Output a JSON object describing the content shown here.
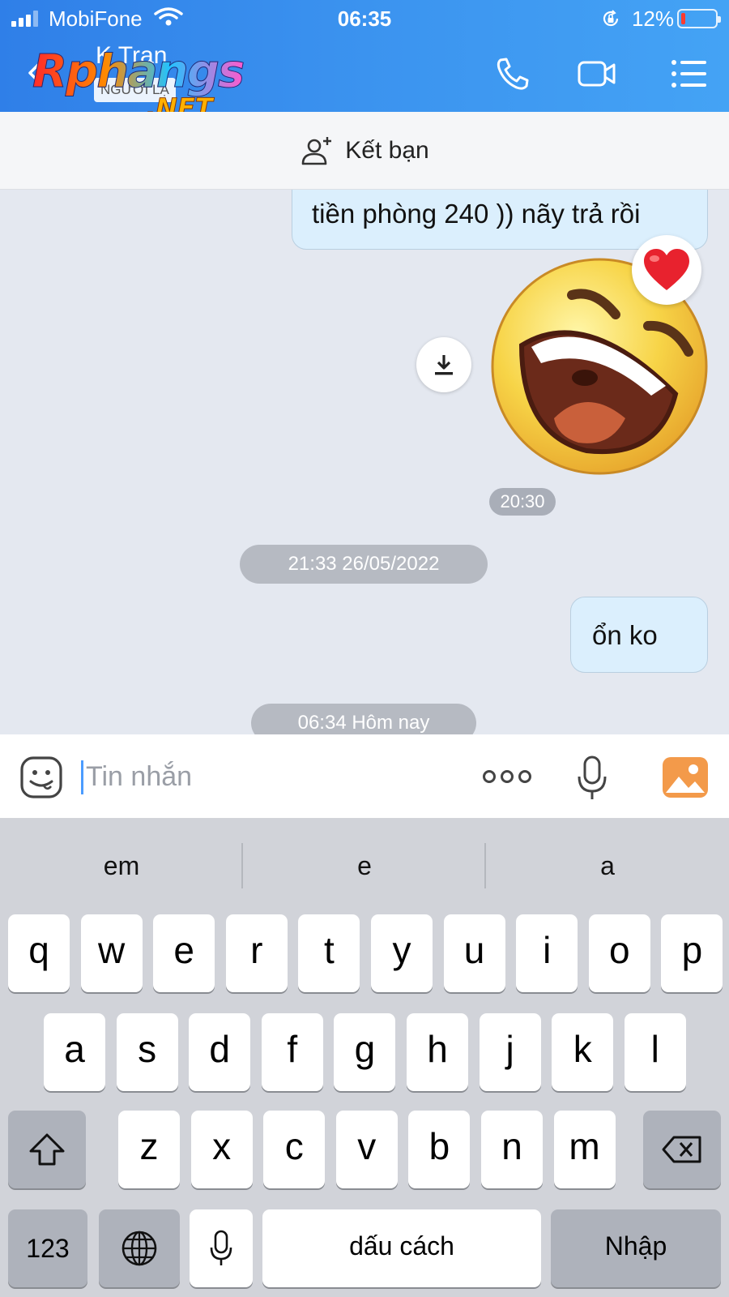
{
  "status_bar": {
    "carrier": "MobiFone",
    "time": "06:35",
    "battery_percent": "12%",
    "battery_level": 0.12
  },
  "header": {
    "contact_name": "K Tran",
    "badge": "NGƯỜI LẠ",
    "watermark_main": "Rphangs",
    "watermark_net": ".NET"
  },
  "add_friend_label": "Kết bạn",
  "messages": {
    "bubble1_text": "tiền phòng 240 )) nãy trả rồi",
    "sticker_time": "20:30",
    "date_separator1": "21:33 26/05/2022",
    "bubble2_text": "ổn ko",
    "date_separator2": "06:34 Hôm nay"
  },
  "composer": {
    "placeholder": "Tin nhắn",
    "value": ""
  },
  "keyboard": {
    "suggestions": [
      "em",
      "e",
      "a"
    ],
    "row1": [
      "q",
      "w",
      "e",
      "r",
      "t",
      "y",
      "u",
      "i",
      "o",
      "p"
    ],
    "row2": [
      "a",
      "s",
      "d",
      "f",
      "g",
      "h",
      "j",
      "k",
      "l"
    ],
    "row3": [
      "z",
      "x",
      "c",
      "v",
      "b",
      "n",
      "m"
    ],
    "numbers_label": "123",
    "space_label": "dấu cách",
    "return_label": "Nhập"
  },
  "colors": {
    "header_start": "#2f7fe8",
    "header_end": "#44a3f5",
    "bubble": "#dbeffd",
    "chat_bg": "#e4e8f0",
    "keyboard_bg": "#d1d3d9"
  }
}
